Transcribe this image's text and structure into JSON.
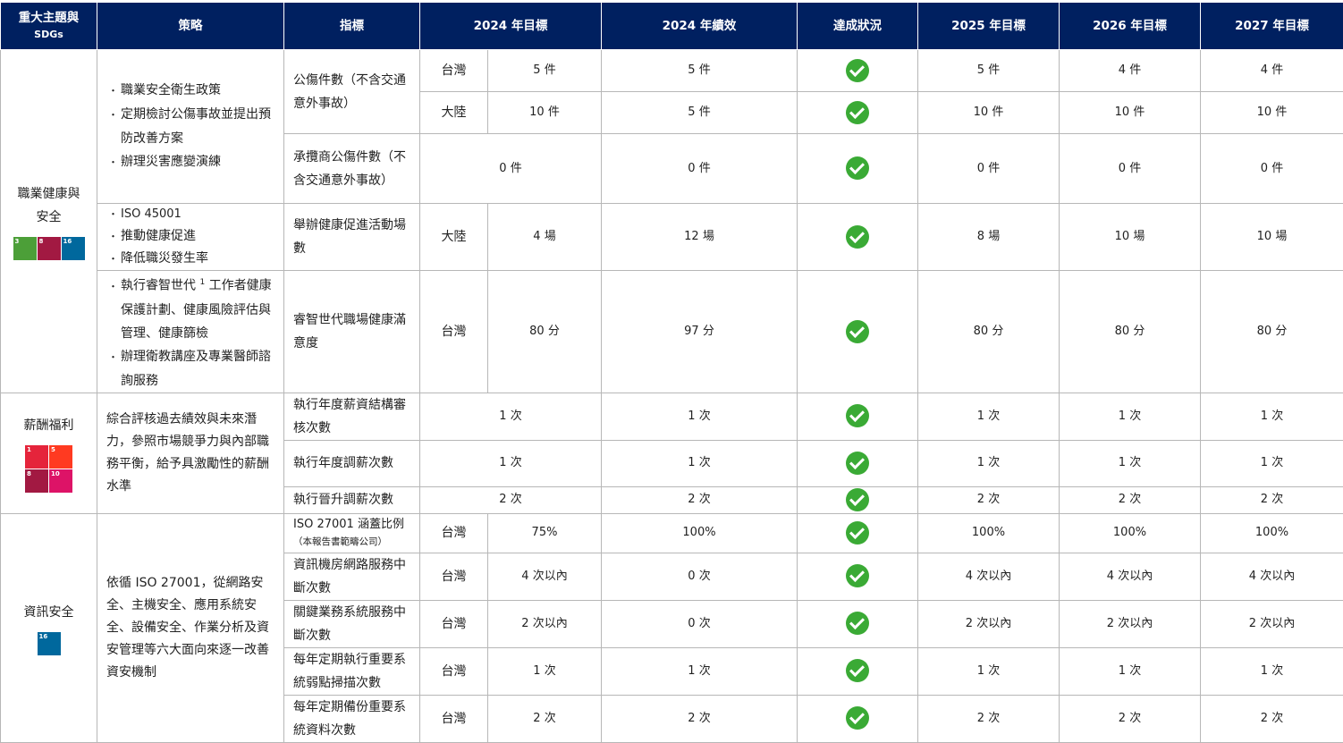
{
  "header": {
    "theme": "重大主題與",
    "theme_sub": "SDGs",
    "strategy": "策略",
    "indicator": "指標",
    "target2024": "2024 年目標",
    "perf2024": "2024 年績效",
    "status": "達成狀況",
    "target2025": "2025 年目標",
    "target2026": "2026 年目標",
    "target2027": "2027 年目標"
  },
  "ohs": {
    "theme": "職業健康與安全",
    "sdgs": [
      {
        "num": "3",
        "color": "#4c9f38",
        "icon": "heartbeat-icon"
      },
      {
        "num": "8",
        "color": "#a21942",
        "icon": "growth-chart-icon"
      },
      {
        "num": "16",
        "color": "#00689d",
        "icon": "dove-icon"
      }
    ],
    "strategy1": [
      "職業安全衛生政策",
      "定期檢討公傷事故並提出預防改善方案",
      "辦理災害應變演練"
    ],
    "strategy2": [
      "ISO 45001",
      "推動健康促進",
      "降低職災發生率"
    ],
    "strategy3_a": "執行睿智世代",
    "strategy3_sup": "1",
    "strategy3_b": "工作者健康保護計劃、健康風險評估與管理、健康篩檢",
    "strategy3_2": "辦理衛教講座及專業醫師諮詢服務",
    "rows": [
      {
        "indicator": "公傷件數（不含交通意外事故）",
        "region": "台灣",
        "t2024": "5 件",
        "p2024": "5 件",
        "t2025": "5 件",
        "t2026": "4 件",
        "t2027": "4 件"
      },
      {
        "region": "大陸",
        "t2024": "10 件",
        "p2024": "5 件",
        "t2025": "10 件",
        "t2026": "10 件",
        "t2027": "10 件"
      },
      {
        "indicator": "承攬商公傷件數（不含交通意外事故）",
        "t2024": "0 件",
        "p2024": "0 件",
        "t2025": "0 件",
        "t2026": "0 件",
        "t2027": "0 件"
      },
      {
        "indicator": "舉辦健康促進活動場數",
        "region": "大陸",
        "t2024": "4 場",
        "p2024": "12 場",
        "t2025": "8 場",
        "t2026": "10 場",
        "t2027": "10 場"
      },
      {
        "indicator": "睿智世代職場健康滿意度",
        "region": "台灣",
        "t2024": "80 分",
        "p2024": "97 分",
        "t2025": "80 分",
        "t2026": "80 分",
        "t2027": "80 分"
      }
    ]
  },
  "comp": {
    "theme": "薪酬福利",
    "sdgs": [
      {
        "num": "1",
        "color": "#e5243b",
        "icon": "family-icon"
      },
      {
        "num": "5",
        "color": "#ff3a21",
        "icon": "gender-icon"
      },
      {
        "num": "8",
        "color": "#a21942",
        "icon": "growth-chart-icon"
      },
      {
        "num": "10",
        "color": "#dd1367",
        "icon": "equality-icon"
      }
    ],
    "strategy": "綜合評核過去績效與未來潛力，參照市場競爭力與內部職務平衡，給予具激勵性的薪酬水準",
    "rows": [
      {
        "indicator": "執行年度薪資結構審核次數",
        "t2024": "1 次",
        "p2024": "1 次",
        "t2025": "1 次",
        "t2026": "1 次",
        "t2027": "1 次"
      },
      {
        "indicator": "執行年度調薪次數",
        "t2024": "1 次",
        "p2024": "1 次",
        "t2025": "1 次",
        "t2026": "1 次",
        "t2027": "1 次"
      },
      {
        "indicator": "執行晉升調薪次數",
        "t2024": "2 次",
        "p2024": "2 次",
        "t2025": "2 次",
        "t2026": "2 次",
        "t2027": "2 次"
      }
    ]
  },
  "infosec": {
    "theme": "資訊安全",
    "sdgs": [
      {
        "num": "16",
        "color": "#00689d",
        "icon": "dove-icon"
      }
    ],
    "strategy": "依循 ISO 27001，從網路安全、主機安全、應用系統安全、設備安全、作業分析及資安管理等六大面向來逐一改善資安機制",
    "rows": [
      {
        "indicator": "ISO 27001 涵蓋比例",
        "note": "（本報告書範疇公司）",
        "region": "台灣",
        "t2024": "75%",
        "p2024": "100%",
        "t2025": "100%",
        "t2026": "100%",
        "t2027": "100%"
      },
      {
        "indicator": "資訊機房網路服務中斷次數",
        "region": "台灣",
        "t2024": "4 次以內",
        "p2024": "0 次",
        "t2025": "4 次以內",
        "t2026": "4 次以內",
        "t2027": "4 次以內"
      },
      {
        "indicator": "關鍵業務系統服務中斷次數",
        "region": "台灣",
        "t2024": "2 次以內",
        "p2024": "0 次",
        "t2025": "2 次以內",
        "t2026": "2 次以內",
        "t2027": "2 次以內"
      },
      {
        "indicator": "每年定期執行重要系統弱點掃描次數",
        "region": "台灣",
        "t2024": "1 次",
        "p2024": "1 次",
        "t2025": "1 次",
        "t2026": "1 次",
        "t2027": "1 次"
      },
      {
        "indicator": "每年定期備份重要系統資料次數",
        "region": "台灣",
        "t2024": "2 次",
        "p2024": "2 次",
        "t2025": "2 次",
        "t2026": "2 次",
        "t2027": "2 次"
      }
    ]
  },
  "status_icon": "check-circle-icon"
}
